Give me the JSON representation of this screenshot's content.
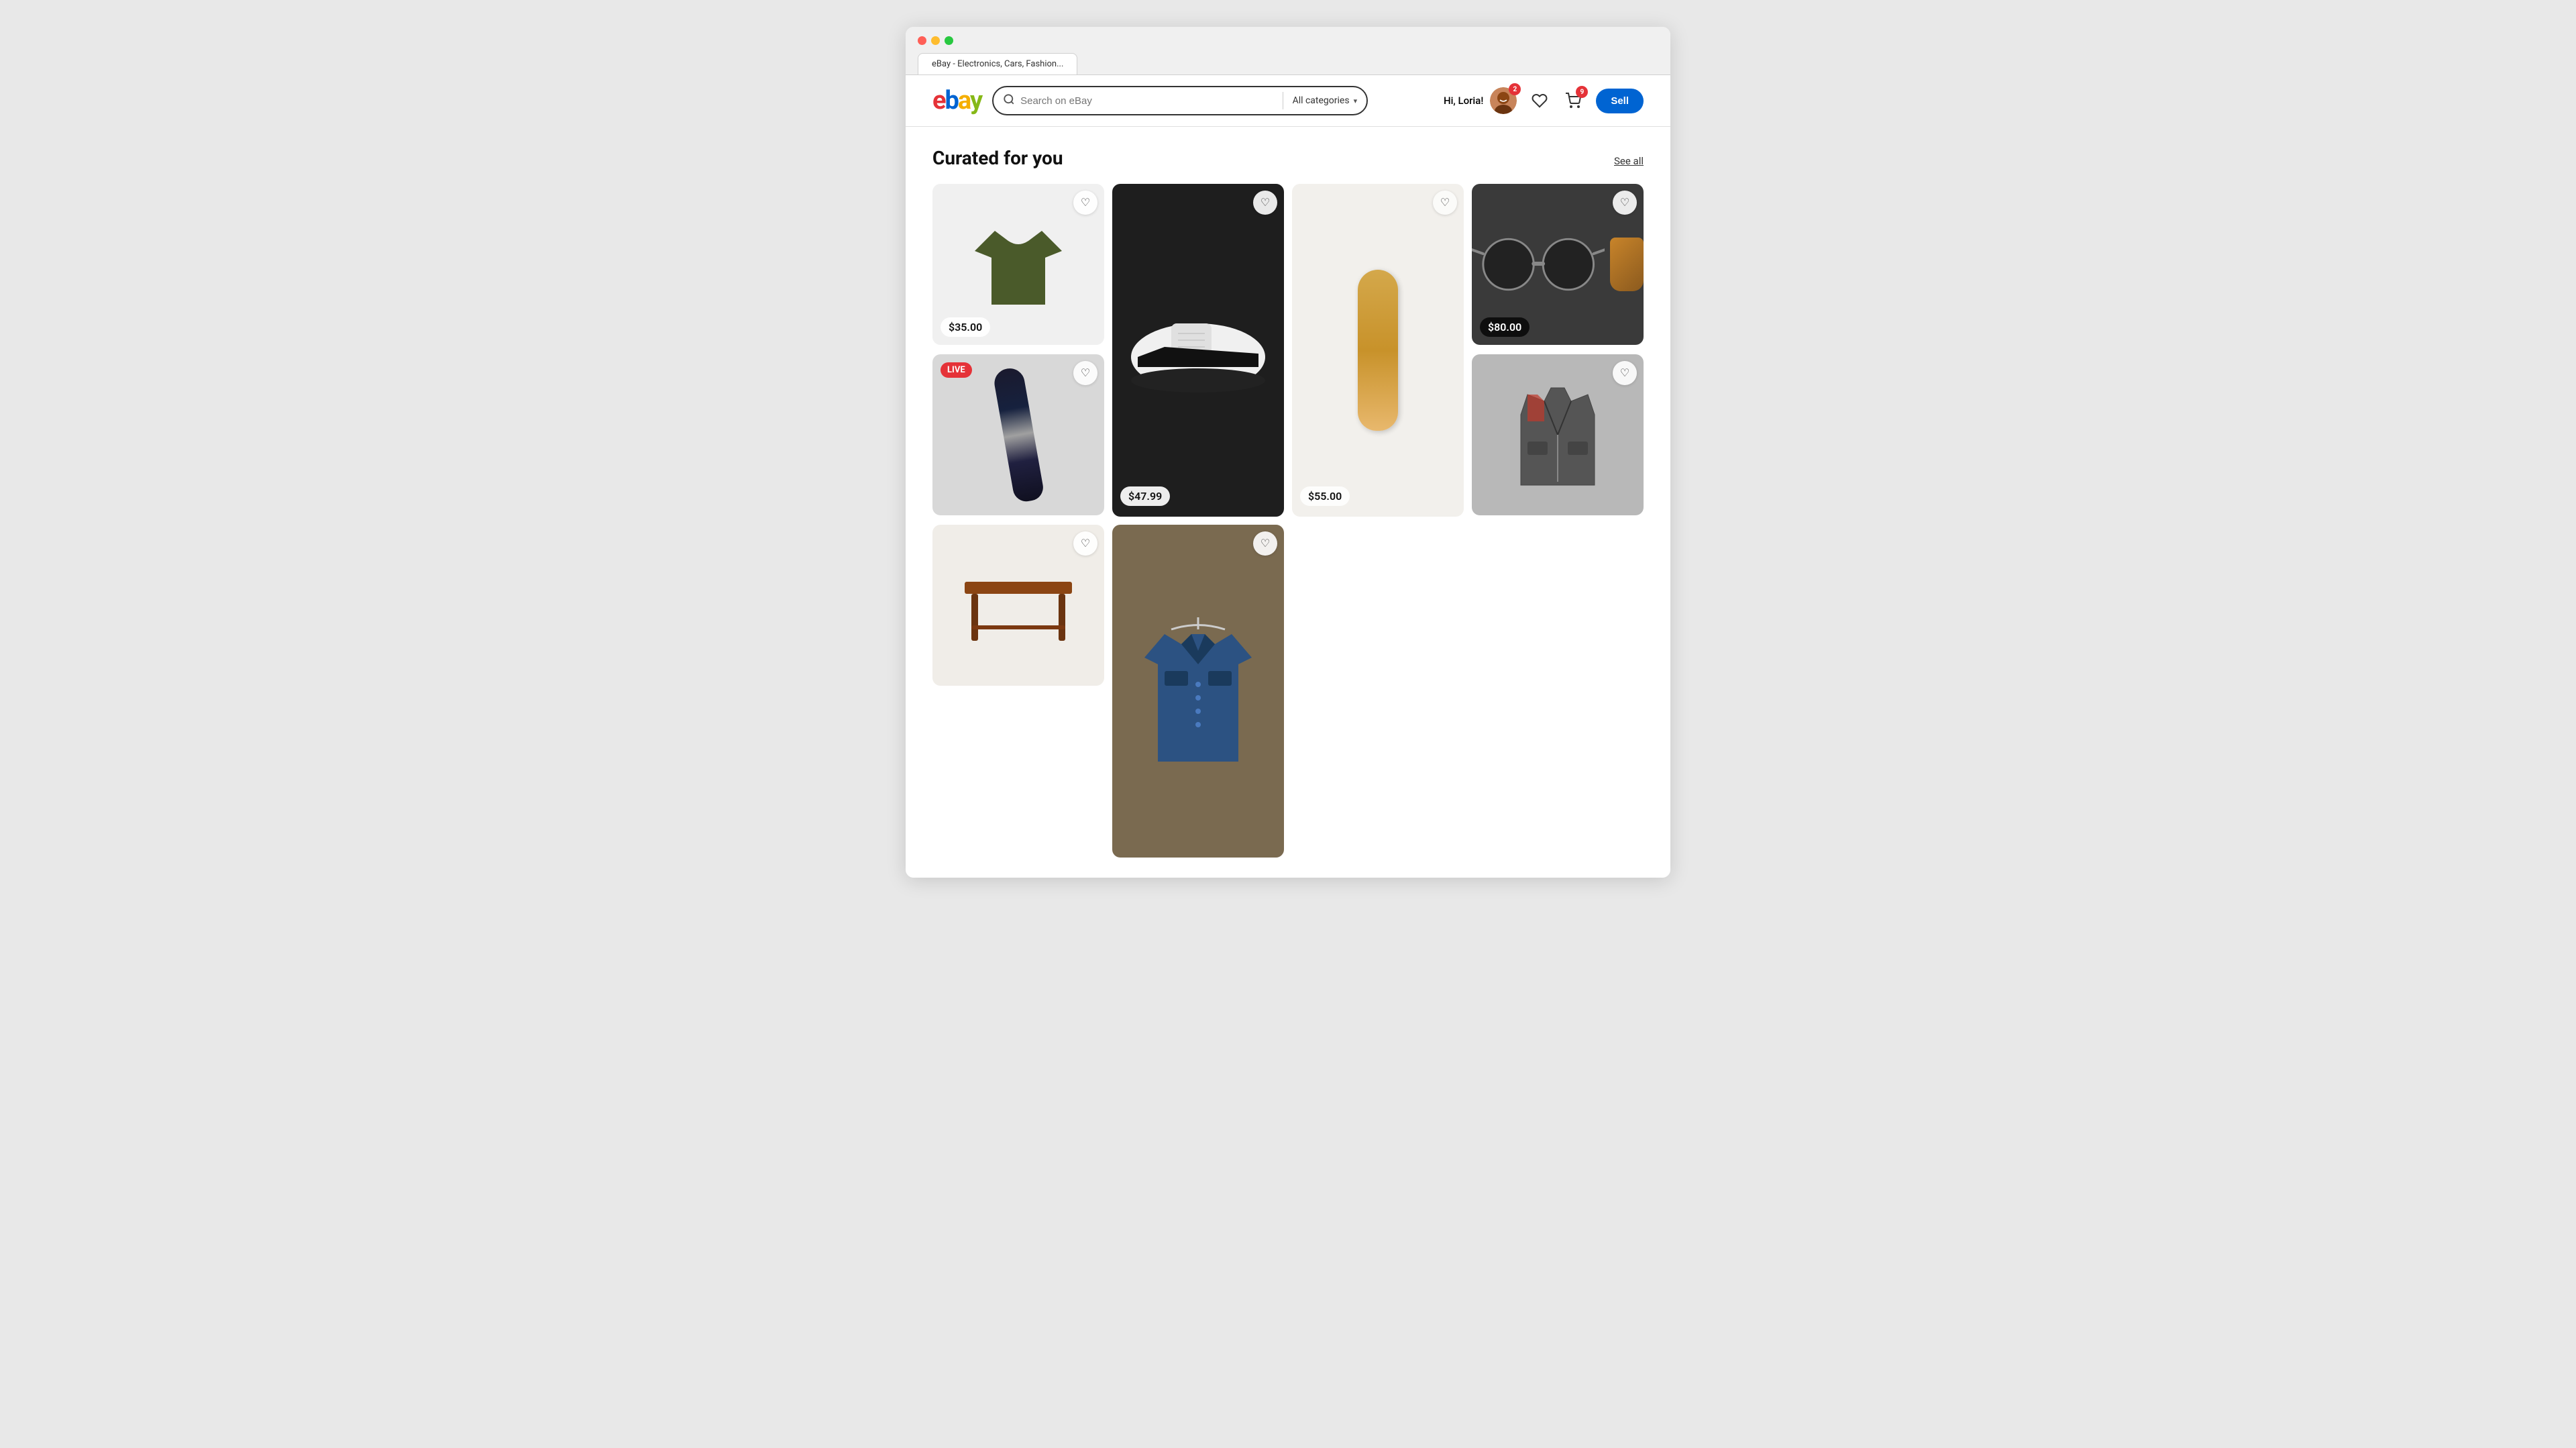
{
  "browser": {
    "tab_label": "eBay - Electronics, Cars, Fashion..."
  },
  "header": {
    "logo": {
      "e": "e",
      "b": "b",
      "a": "a",
      "y": "y"
    },
    "search": {
      "placeholder": "Search on eBay",
      "categories_label": "All categories"
    },
    "user": {
      "greeting": "Hi, Loria!",
      "notification_count": "2",
      "cart_count": "9"
    },
    "sell_label": "Sell"
  },
  "main": {
    "section_title": "Curated for you",
    "see_all_label": "See all",
    "products": [
      {
        "id": "p1",
        "type": "tshirt",
        "price": "$35.00",
        "has_price": true,
        "is_live": false,
        "is_tall": false,
        "bg": "#f0f0f0"
      },
      {
        "id": "p2",
        "type": "shoes",
        "price": "$47.99",
        "has_price": true,
        "is_live": false,
        "is_tall": true,
        "bg": "#2a2a2a"
      },
      {
        "id": "p3",
        "type": "skateboard",
        "price": "$55.00",
        "has_price": true,
        "is_live": false,
        "is_tall": true,
        "bg": "#f2f0ec"
      },
      {
        "id": "p4",
        "type": "sunglasses",
        "price": "$80.00",
        "has_price": true,
        "is_live": false,
        "is_tall": false,
        "bg": "#4a4a4a"
      },
      {
        "id": "p5",
        "type": "snowboard",
        "price": "",
        "has_price": false,
        "is_live": true,
        "live_label": "LIVE",
        "is_tall": false,
        "bg": "#d8d8d8"
      },
      {
        "id": "p6",
        "type": "vest",
        "price": "",
        "has_price": false,
        "is_live": false,
        "is_tall": false,
        "bg": "#b8b8b8"
      },
      {
        "id": "p7",
        "type": "table",
        "price": "",
        "has_price": false,
        "is_live": false,
        "is_tall": false,
        "bg": "#f0ede8"
      },
      {
        "id": "p8",
        "type": "jacket",
        "price": "",
        "has_price": false,
        "is_live": false,
        "is_tall": true,
        "bg": "#7a6a50"
      }
    ]
  }
}
